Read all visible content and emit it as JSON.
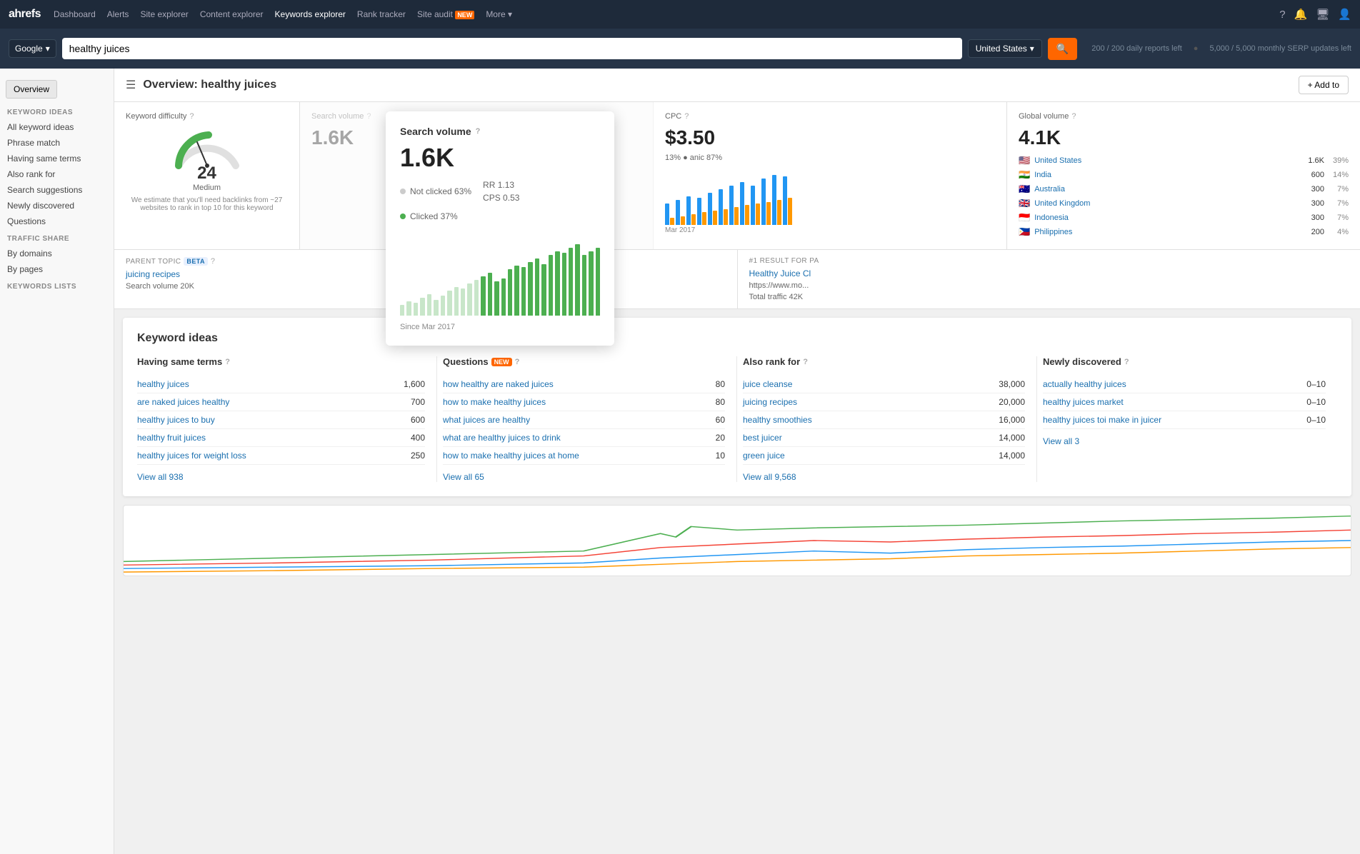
{
  "nav": {
    "logo": "ahrefs",
    "links": [
      {
        "label": "Dashboard",
        "active": false
      },
      {
        "label": "Alerts",
        "active": false
      },
      {
        "label": "Site explorer",
        "active": false
      },
      {
        "label": "Content explorer",
        "active": false
      },
      {
        "label": "Keywords explorer",
        "active": true
      },
      {
        "label": "Rank tracker",
        "active": false
      },
      {
        "label": "Site audit",
        "active": false,
        "badge": "NEW"
      },
      {
        "label": "More",
        "active": false
      }
    ]
  },
  "searchBar": {
    "engine": "Google",
    "query": "healthy juices",
    "country": "United States",
    "meta1": "200 / 200 daily reports left",
    "meta2": "5,000 / 5,000 monthly SERP updates left"
  },
  "sidebar": {
    "overview_btn": "Overview",
    "sections": [
      {
        "title": "KEYWORD IDEAS",
        "items": [
          "All keyword ideas",
          "Phrase match",
          "Having same terms",
          "Also rank for",
          "Search suggestions",
          "Newly discovered",
          "Questions"
        ]
      },
      {
        "title": "TRAFFIC SHARE",
        "items": [
          "By domains",
          "By pages"
        ]
      },
      {
        "title": "KEYWORDS LISTS",
        "items": []
      }
    ]
  },
  "pageHeader": {
    "title": "Overview: healthy juices",
    "addToBtn": "+ Add to"
  },
  "cards": {
    "difficulty": {
      "title": "Keyword difficulty",
      "value": "24",
      "label": "Medium",
      "note": "We estimate that you'll need backlinks from ~27 websites to rank in top 10 for this keyword"
    },
    "searchVolume": {
      "title": "Search volume",
      "value": "1.6K",
      "notClicked": "Not clicked 63%",
      "clicked": "Clicked 37%",
      "rr": "RR 1.13",
      "cps": "CPS 0.53",
      "since": "Since Mar 2017"
    },
    "cpc": {
      "title": "CPC",
      "value": "$3.50",
      "stat1": "13%",
      "stat2": "anic 87%"
    },
    "globalVolume": {
      "title": "Global volume",
      "value": "4.1K",
      "countries": [
        {
          "flag": "🇺🇸",
          "name": "United States",
          "count": "1.6K",
          "pct": "39%"
        },
        {
          "flag": "🇮🇳",
          "name": "India",
          "count": "600",
          "pct": "14%"
        },
        {
          "flag": "🇦🇺",
          "name": "Australia",
          "count": "300",
          "pct": "7%"
        },
        {
          "flag": "🇬🇧",
          "name": "United Kingdom",
          "count": "300",
          "pct": "7%"
        },
        {
          "flag": "🇮🇩",
          "name": "Indonesia",
          "count": "300",
          "pct": "7%"
        },
        {
          "flag": "🇵🇭",
          "name": "Philippines",
          "count": "200",
          "pct": "4%"
        }
      ]
    }
  },
  "parentTopic": {
    "label": "Parent topic",
    "betaBadge": "BETA",
    "link": "juicing recipes",
    "volumeLabel": "Search volume 20K",
    "result1Label": "#1 result for pa",
    "result1Link": "Healthy Juice Cl",
    "result1Url": "https://www.mo...",
    "result1Traffic": "Total traffic 42K"
  },
  "keywordIdeas": {
    "sectionTitle": "Keyword ideas",
    "columns": [
      {
        "header": "Having same terms",
        "hasHelp": true,
        "keywords": [
          {
            "text": "healthy juices",
            "count": "1,600"
          },
          {
            "text": "are naked juices healthy",
            "count": "700"
          },
          {
            "text": "healthy juices to buy",
            "count": "600"
          },
          {
            "text": "healthy fruit juices",
            "count": "400"
          },
          {
            "text": "healthy juices for weight loss",
            "count": "250"
          }
        ],
        "viewAll": "View all 938"
      },
      {
        "header": "Questions",
        "hasHelp": true,
        "newBadge": "NEW",
        "keywords": [
          {
            "text": "how healthy are naked juices",
            "count": "80"
          },
          {
            "text": "how to make healthy juices",
            "count": "80"
          },
          {
            "text": "what juices are healthy",
            "count": "60"
          },
          {
            "text": "what are healthy juices to drink",
            "count": "20"
          },
          {
            "text": "how to make healthy juices at home",
            "count": "10"
          }
        ],
        "viewAll": "View all 65"
      },
      {
        "header": "Also rank for",
        "hasHelp": true,
        "keywords": [
          {
            "text": "juice cleanse",
            "count": "38,000"
          },
          {
            "text": "juicing recipes",
            "count": "20,000"
          },
          {
            "text": "healthy smoothies",
            "count": "16,000"
          },
          {
            "text": "best juicer",
            "count": "14,000"
          },
          {
            "text": "green juice",
            "count": "14,000"
          }
        ],
        "viewAll": "View all 9,568"
      },
      {
        "header": "Newly discovered",
        "hasHelp": true,
        "keywords": [
          {
            "text": "actually healthy juices",
            "count": "0–10"
          },
          {
            "text": "healthy juices market",
            "count": "0–10"
          },
          {
            "text": "healthy juices toi make in juicer",
            "count": "0–10"
          }
        ],
        "viewAll": "View all 3"
      }
    ]
  },
  "popup": {
    "title": "Search volume",
    "value": "1.6K",
    "notClicked": "Not clicked 63%",
    "clicked": "Clicked 37%",
    "rr": "RR 1.13",
    "cps": "CPS 0.53",
    "since": "Since Mar 2017",
    "chartBars": [
      15,
      20,
      18,
      25,
      30,
      22,
      28,
      35,
      40,
      38,
      45,
      50,
      55,
      60,
      48,
      52,
      65,
      70,
      68,
      75,
      80,
      72,
      85,
      90,
      88,
      95,
      100,
      85,
      90,
      95
    ]
  }
}
